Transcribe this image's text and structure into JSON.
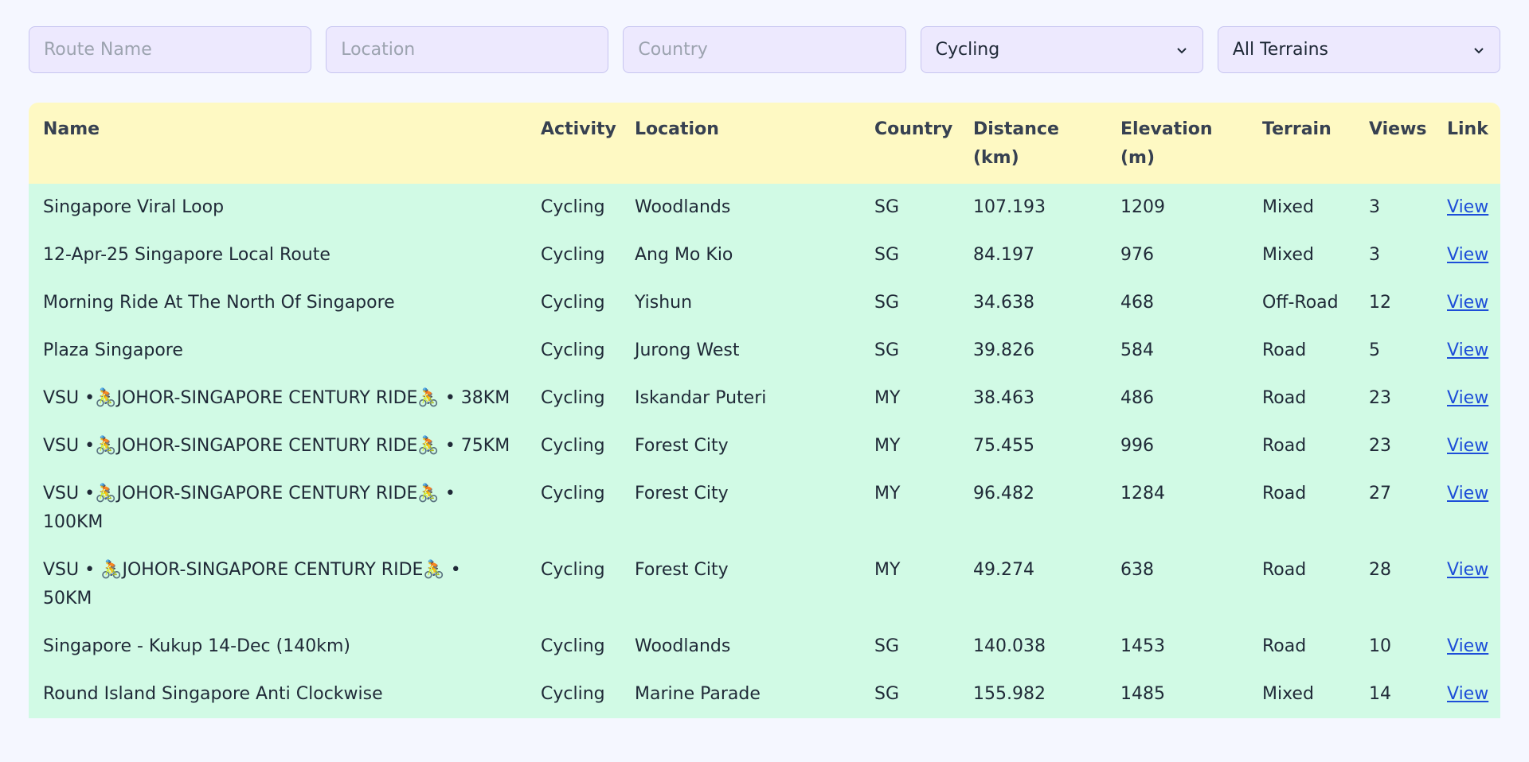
{
  "filters": {
    "route_name_placeholder": "Route Name",
    "location_placeholder": "Location",
    "country_placeholder": "Country",
    "activity_selected": "Cycling",
    "terrain_selected": "All Terrains"
  },
  "table": {
    "headers": {
      "name": "Name",
      "activity": "Activity",
      "location": "Location",
      "country": "Country",
      "distance": "Distance (km)",
      "elevation": "Elevation (m)",
      "terrain": "Terrain",
      "views": "Views",
      "link": "Link"
    },
    "rows": [
      {
        "name": "Singapore Viral Loop",
        "activity": "Cycling",
        "location": "Woodlands",
        "country": "SG",
        "distance": "107.193",
        "elevation": "1209",
        "terrain": "Mixed",
        "views": "3",
        "link": "View"
      },
      {
        "name": "12-Apr-25 Singapore Local Route",
        "activity": "Cycling",
        "location": "Ang Mo Kio",
        "country": "SG",
        "distance": "84.197",
        "elevation": "976",
        "terrain": "Mixed",
        "views": "3",
        "link": "View"
      },
      {
        "name": "Morning Ride At The North Of Singapore",
        "activity": "Cycling",
        "location": "Yishun",
        "country": "SG",
        "distance": "34.638",
        "elevation": "468",
        "terrain": "Off-Road",
        "views": "12",
        "link": "View"
      },
      {
        "name": "Plaza Singapore",
        "activity": "Cycling",
        "location": "Jurong West",
        "country": "SG",
        "distance": "39.826",
        "elevation": "584",
        "terrain": "Road",
        "views": "5",
        "link": "View"
      },
      {
        "name": "VSU •🚴JOHOR-SINGAPORE CENTURY RIDE🚴 • 38KM",
        "activity": "Cycling",
        "location": "Iskandar Puteri",
        "country": "MY",
        "distance": "38.463",
        "elevation": "486",
        "terrain": "Road",
        "views": "23",
        "link": "View"
      },
      {
        "name": "VSU •🚴JOHOR-SINGAPORE CENTURY RIDE🚴 • 75KM",
        "activity": "Cycling",
        "location": "Forest City",
        "country": "MY",
        "distance": "75.455",
        "elevation": "996",
        "terrain": "Road",
        "views": "23",
        "link": "View"
      },
      {
        "name": "VSU •🚴JOHOR-SINGAPORE CENTURY RIDE🚴 • 100KM",
        "activity": "Cycling",
        "location": "Forest City",
        "country": "MY",
        "distance": "96.482",
        "elevation": "1284",
        "terrain": "Road",
        "views": "27",
        "link": "View"
      },
      {
        "name": "VSU • 🚴JOHOR-SINGAPORE CENTURY RIDE🚴 • 50KM",
        "activity": "Cycling",
        "location": "Forest City",
        "country": "MY",
        "distance": "49.274",
        "elevation": "638",
        "terrain": "Road",
        "views": "28",
        "link": "View"
      },
      {
        "name": "Singapore - Kukup 14-Dec (140km)",
        "activity": "Cycling",
        "location": "Woodlands",
        "country": "SG",
        "distance": "140.038",
        "elevation": "1453",
        "terrain": "Road",
        "views": "10",
        "link": "View"
      },
      {
        "name": "Round Island Singapore Anti Clockwise",
        "activity": "Cycling",
        "location": "Marine Parade",
        "country": "SG",
        "distance": "155.982",
        "elevation": "1485",
        "terrain": "Mixed",
        "views": "14",
        "link": "View"
      }
    ]
  },
  "colors": {
    "page_bg": "#f5f7ff",
    "input_bg": "#ede9fe",
    "header_bg": "#fef9c3",
    "row_bg": "#d1fae5",
    "link": "#1d4ed8"
  },
  "icons": {
    "select_arrow": "chevron-down-icon"
  }
}
